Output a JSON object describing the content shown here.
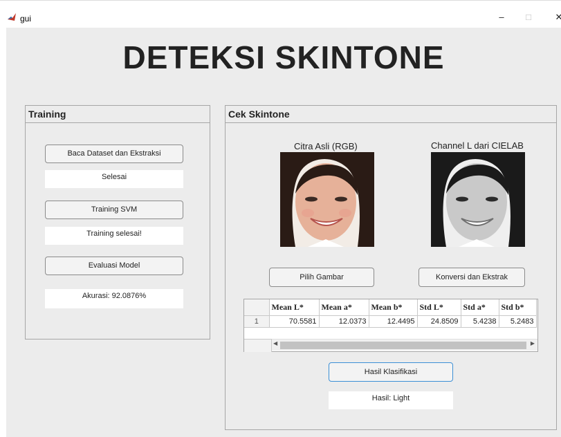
{
  "window": {
    "title": "gui",
    "controls": {
      "minimize": "–",
      "maximize": "□",
      "close": "✕"
    }
  },
  "app": {
    "title": "DETEKSI SKINTONE"
  },
  "training": {
    "panel_title": "Training",
    "read_button": "Baca Dataset dan Ekstraksi",
    "read_status": "Selesai",
    "train_button": "Training SVM",
    "train_status": "Training selesai!",
    "eval_button": "Evaluasi Model",
    "eval_status": "Akurasi: 92.0876%"
  },
  "cek": {
    "panel_title": "Cek Skintone",
    "image_left_caption": "Citra Asli (RGB)",
    "image_right_caption": "Channel L dari CIELAB",
    "pick_button": "Pilih Gambar",
    "convert_button": "Konversi dan Ekstrak",
    "table": {
      "columns": [
        "Mean L*",
        "Mean a*",
        "Mean b*",
        "Std L*",
        "Std a*",
        "Std b*"
      ],
      "rows": [
        {
          "index": "1",
          "values": [
            "70.5581",
            "12.0373",
            "12.4495",
            "24.8509",
            "5.4238",
            "5.2483"
          ]
        }
      ]
    },
    "classify_button": "Hasil Klasifikasi",
    "result": "Hasil: Light"
  },
  "colors": {
    "figure_bg": "#ececec",
    "panel_border": "#a6a6a6",
    "accent_border": "#3b8fd6"
  },
  "icons": [
    "matlab-app-icon",
    "photo-face-color",
    "photo-face-grayscale",
    "scroll-left-arrow",
    "scroll-right-arrow"
  ]
}
